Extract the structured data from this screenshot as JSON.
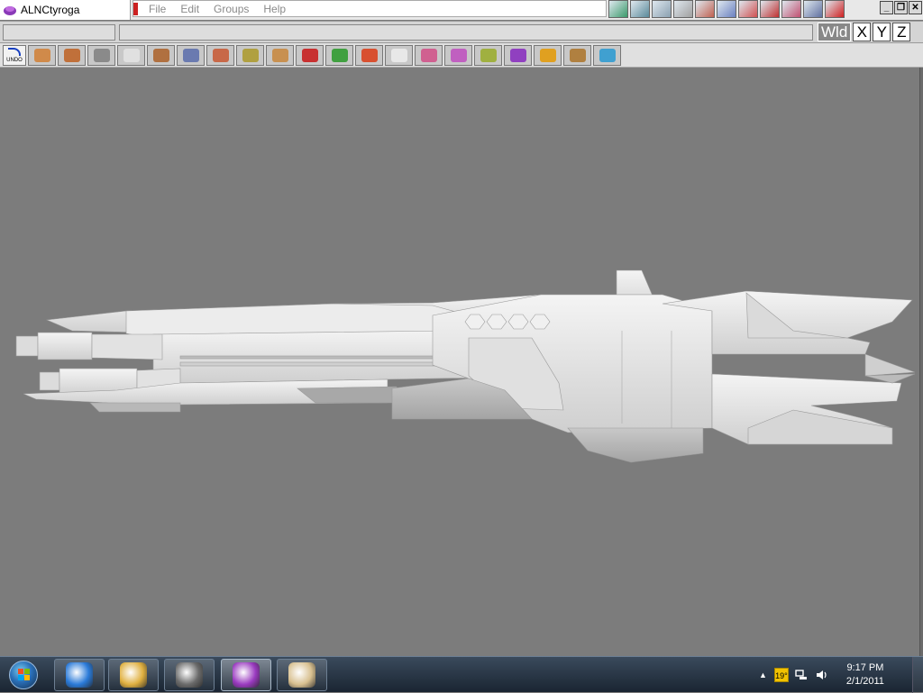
{
  "window": {
    "title": "ALNCtyroga"
  },
  "menu": {
    "items": [
      "File",
      "Edit",
      "Groups",
      "Help"
    ]
  },
  "top_icons": [
    "green-mesh-icon",
    "axis-mesh-icon",
    "wire-mesh-icon",
    "grid-icon",
    "cross-icon",
    "pattern-icon",
    "color-grid-icon",
    "house-icon",
    "monitor-icon",
    "flag-icon",
    "help-icon"
  ],
  "window_controls": {
    "minimize": "_",
    "restore": "❐",
    "close": "✕"
  },
  "coords": {
    "world": "Wld",
    "x": "X",
    "y": "Y",
    "z": "Z"
  },
  "toolbar": {
    "undo_label": "UNDO",
    "tools": [
      "undo-icon",
      "paint-icon",
      "box-icon",
      "camera-icon",
      "select-arrow-icon",
      "move-icon",
      "scale-icon",
      "cube-icon",
      "extrude-icon",
      "sphere-icon",
      "color-sphere-icon",
      "bend-icon",
      "light-icon",
      "curve-icon",
      "knife-icon",
      "brush-icon",
      "texture-icon",
      "axes-icon",
      "sun-icon",
      "material-icon",
      "render-3d-icon"
    ],
    "colors": [
      "#f2f2f2",
      "#d08a4a",
      "#c0703a",
      "#8a8a8a",
      "#e0e0e0",
      "#b07040",
      "#6a7ab0",
      "#c86848",
      "#b0a040",
      "#c89050",
      "#c83030",
      "#40a040",
      "#d85030",
      "#e8e8e8",
      "#d06090",
      "#c060c0",
      "#a0b040",
      "#9040c0",
      "#e0a020",
      "#b08040",
      "#40a0d0"
    ]
  },
  "taskbar": {
    "apps": [
      "internet-explorer-icon",
      "explorer-icon",
      "calculator-icon",
      "modeler-app-icon",
      "paint-icon"
    ],
    "active_index": 3,
    "weather": "19°",
    "clock_time": "9:17 PM",
    "clock_date": "2/1/2011"
  },
  "colors": {
    "viewport_bg": "#7c7c7c",
    "model_light": "#f0f0f0",
    "model_mid": "#d8d8d8",
    "model_shadow": "#b4b4b4"
  }
}
